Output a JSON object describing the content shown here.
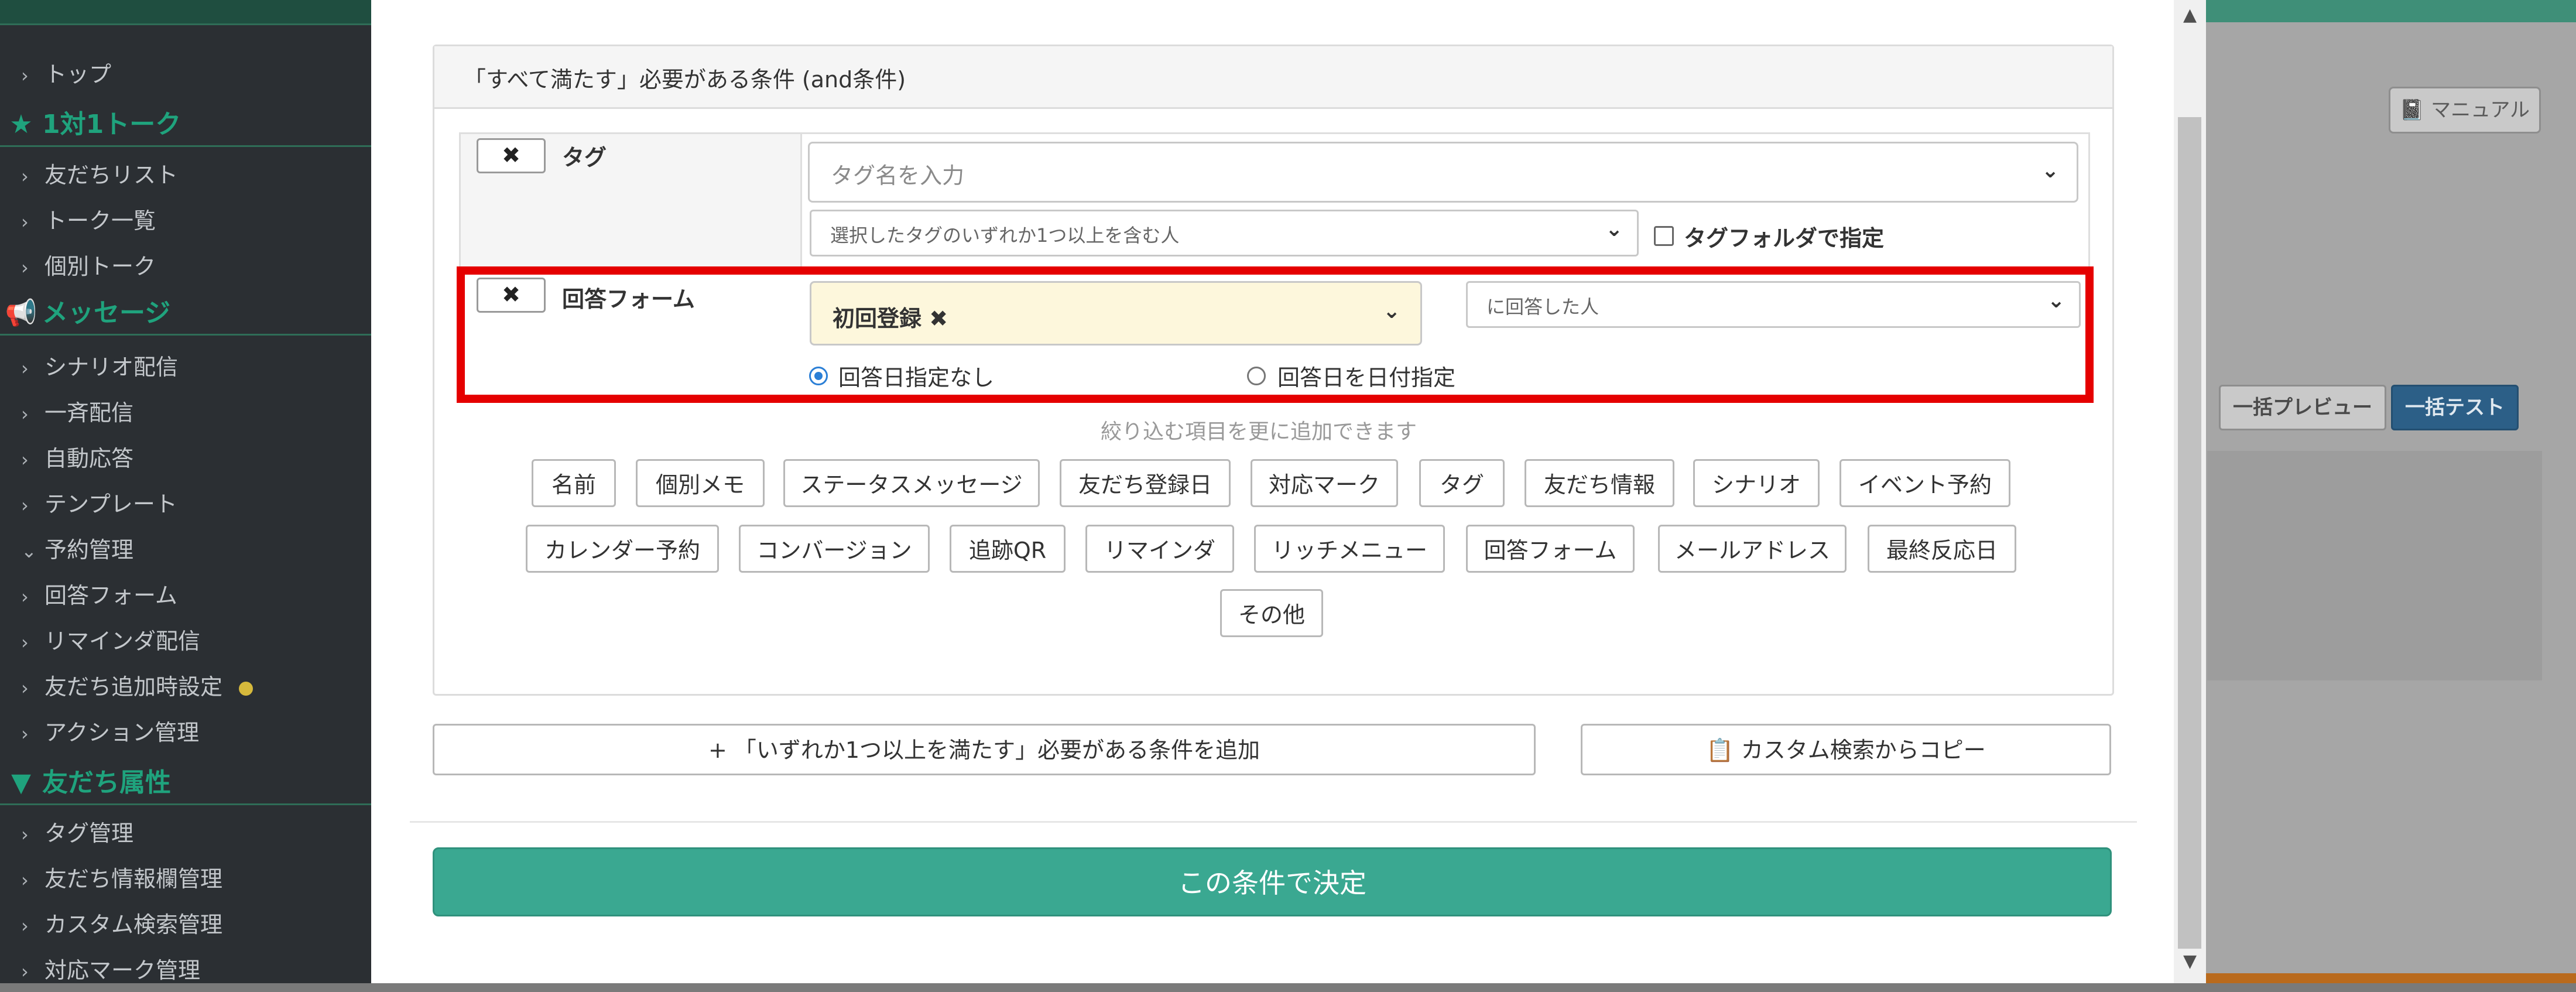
{
  "sidebar": {
    "items": [
      {
        "label": "トップ",
        "chev": "›"
      },
      {
        "label": "友だちリスト",
        "chev": "›"
      },
      {
        "label": "トーク一覧",
        "chev": "›"
      },
      {
        "label": "個別トーク",
        "chev": "›"
      },
      {
        "label": "シナリオ配信",
        "chev": "›"
      },
      {
        "label": "一斉配信",
        "chev": "›"
      },
      {
        "label": "自動応答",
        "chev": "›"
      },
      {
        "label": "テンプレート",
        "chev": "›"
      },
      {
        "label": "予約管理",
        "chev": "⌄"
      },
      {
        "label": "回答フォーム",
        "chev": "›"
      },
      {
        "label": "リマインダ配信",
        "chev": "›"
      },
      {
        "label": "友だち追加時設定",
        "chev": "›"
      },
      {
        "label": "アクション管理",
        "chev": "›"
      },
      {
        "label": "タグ管理",
        "chev": "›"
      },
      {
        "label": "友だち情報欄管理",
        "chev": "›"
      },
      {
        "label": "カスタム検索管理",
        "chev": "›"
      },
      {
        "label": "対応マーク管理",
        "chev": "›"
      }
    ],
    "sections": [
      {
        "label": "1対1トーク",
        "icon": "★"
      },
      {
        "label": "メッセージ",
        "icon": "📢"
      },
      {
        "label": "友だち属性",
        "icon": "▼"
      }
    ]
  },
  "background": {
    "manual_label": "マニュアル",
    "manual_icon": "📓",
    "preview_label": "一括プレビュー",
    "test_label": "一括テスト"
  },
  "modal": {
    "condition_title": "「すべて満たす」必要がある条件 (and条件)",
    "x_glyph": "✖",
    "tag_row": {
      "label": "タグ",
      "input_placeholder": "タグ名を入力",
      "match_select": "選択したタグのいずれか1つ以上を含む人",
      "folder_checkbox_label": "タグフォルダで指定"
    },
    "form_row": {
      "label": "回答フォーム",
      "selected_form": "初回登録 ✖",
      "answer_select": "に回答した人",
      "radio_no_date": "回答日指定なし",
      "radio_date": "回答日を日付指定"
    },
    "hint": "絞り込む項目を更に追加できます",
    "filter_chips_row1": [
      "名前",
      "個別メモ",
      "ステータスメッセージ",
      "友だち登録日",
      "対応マーク",
      "タグ",
      "友だち情報",
      "シナリオ",
      "イベント予約"
    ],
    "filter_chips_row2": [
      "カレンダー予約",
      "コンバージョン",
      "追跡QR",
      "リマインダ",
      "リッチメニュー",
      "回答フォーム",
      "メールアドレス",
      "最終反応日"
    ],
    "filter_chips_row3": [
      "その他"
    ],
    "add_or_button": "+ 「いずれか1つ以上を満たす」必要がある条件を追加",
    "copy_button": "カスタム検索からコピー",
    "copy_icon": "📋",
    "submit_button": "この条件で決定"
  },
  "scrollbar": {
    "up": "▲",
    "down": "▼"
  },
  "colors": {
    "accent_green": "#3aa891",
    "highlight_red": "#e50000",
    "sidebar_bg": "#2b2f33",
    "sidebar_heading": "#1fa37d"
  }
}
